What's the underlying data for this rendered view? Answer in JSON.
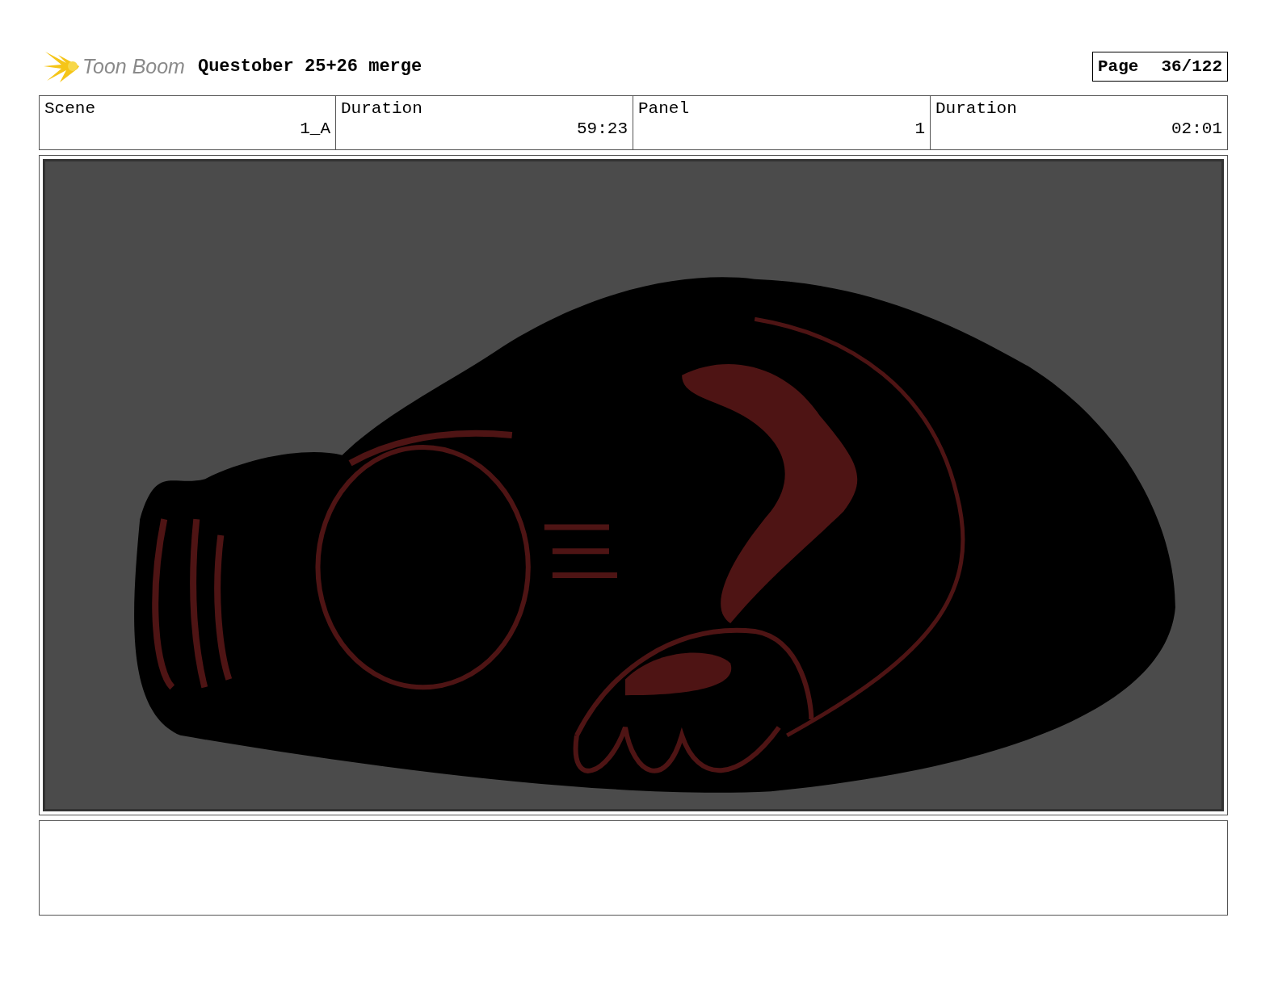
{
  "header": {
    "logo": "Toon Boom",
    "title": "Questober 25+26 merge",
    "page_label": "Page",
    "page_number": "36/122"
  },
  "info": {
    "columns": [
      "Scene",
      "Duration",
      "Panel",
      "Duration"
    ],
    "row": [
      "1_A",
      "59:23",
      "1",
      "02:01"
    ]
  }
}
